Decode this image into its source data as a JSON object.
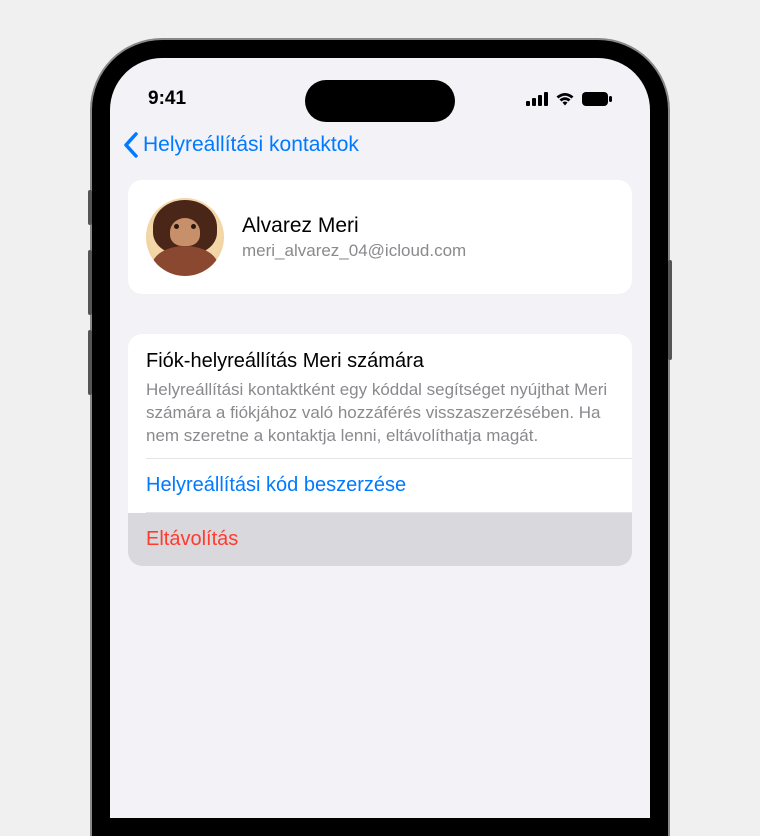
{
  "status": {
    "time": "9:41"
  },
  "nav": {
    "back_label": "Helyreállítási kontaktok"
  },
  "contact": {
    "name": "Alvarez Meri",
    "email": "meri_alvarez_04@icloud.com"
  },
  "recovery": {
    "title": "Fiók-helyreállítás Meri számára",
    "description": "Helyreállítási kontaktként egy kóddal segítséget nyújthat Meri számára a fiókjához való hozzáférés visszaszerzésében. Ha nem szeretne a kontaktja lenni, eltávolíthatja magát.",
    "get_code_label": "Helyreállítási kód beszerzése",
    "remove_label": "Eltávolítás"
  }
}
